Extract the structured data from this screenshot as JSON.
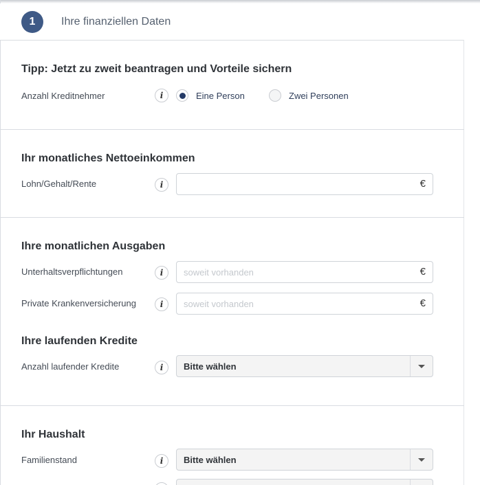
{
  "step": {
    "number": "1",
    "title": "Ihre finanziellen Daten"
  },
  "info_icon_glyph": "i",
  "section_tipp": {
    "heading": "Tipp: Jetzt zu zweit beantragen und Vorteile sichern",
    "borrowers_label": "Anzahl Kreditnehmer",
    "options": [
      {
        "label": "Eine Person",
        "selected": true
      },
      {
        "label": "Zwei Personen",
        "selected": false
      }
    ]
  },
  "section_income": {
    "heading": "Ihr monatliches Nettoeinkommen",
    "salary_label": "Lohn/Gehalt/Rente",
    "salary_value": "",
    "salary_placeholder": "",
    "currency": "€"
  },
  "section_expenses": {
    "heading": "Ihre monatlichen Ausgaben",
    "maintenance_label": "Unterhaltsverpflichtungen",
    "maintenance_placeholder": "soweit vorhanden",
    "insurance_label": "Private Krankenversicherung",
    "insurance_placeholder": "soweit vorhanden",
    "currency": "€"
  },
  "section_credits": {
    "heading": "Ihre laufenden Kredite",
    "count_label": "Anzahl laufender Kredite",
    "count_value": "Bitte wählen"
  },
  "section_household": {
    "heading": "Ihr Haushalt",
    "marital_label": "Familienstand",
    "marital_value": "Bitte wählen"
  },
  "colors": {
    "accent": "#3f5a86",
    "radio_checked": "#243a66"
  }
}
